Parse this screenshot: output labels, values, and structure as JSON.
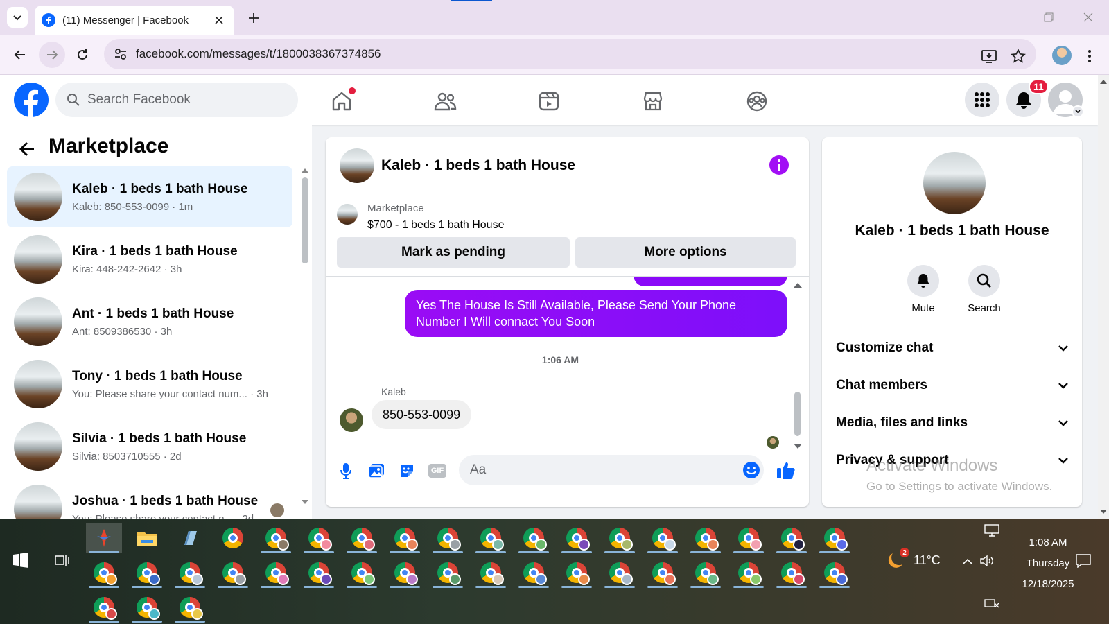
{
  "browser": {
    "tab_title": "(11) Messenger | Facebook",
    "url": "facebook.com/messages/t/1800038367374856"
  },
  "header": {
    "search_placeholder": "Search Facebook",
    "notification_count": "11"
  },
  "sidebar": {
    "title": "Marketplace",
    "chats": [
      {
        "name": "Kaleb · 1 beds 1 bath House",
        "preview": "Kaleb: 850-553-0099 · 1m",
        "active": true
      },
      {
        "name": "Kira · 1 beds 1 bath House",
        "preview": "Kira: 448-242-2642 · 3h"
      },
      {
        "name": "Ant · 1 beds 1 bath House",
        "preview": "Ant: 8509386530 · 3h"
      },
      {
        "name": "Tony · 1 beds 1 bath House",
        "preview": "You: Please share your contact num... · 3h"
      },
      {
        "name": "Silvia · 1 beds 1 bath House",
        "preview": "Silvia: 8503710555 · 2d"
      },
      {
        "name": "Joshua · 1 beds 1 bath House",
        "preview": "You: Please share your contact n... · 2d"
      }
    ]
  },
  "conversation": {
    "title": "Kaleb · 1 beds 1 bath House",
    "listing_source": "Marketplace",
    "listing_title": "$700 - 1 beds 1 bath House",
    "mark_pending_label": "Mark as pending",
    "more_options_label": "More options",
    "outgoing_message": "Yes The House Is Still Available, Please Send Your Phone Number I Will connact You Soon",
    "timestamp": "1:06 AM",
    "sender_name": "Kaleb",
    "incoming_message": "850-553-0099",
    "composer_placeholder": "Aa",
    "gif_label": "GIF"
  },
  "details": {
    "name": "Kaleb · 1 beds 1 bath House",
    "mute_label": "Mute",
    "search_label": "Search",
    "sections": [
      "Customize chat",
      "Chat members",
      "Media, files and links",
      "Privacy & support"
    ]
  },
  "watermark": {
    "line1": "Activate Windows",
    "line2": "Go to Settings to activate Windows."
  },
  "taskbar": {
    "weather_temp": "11°C",
    "weather_badge": "2",
    "time": "1:08 AM",
    "day": "Thursday",
    "date": "12/18/2025"
  },
  "colors": {
    "messenger_purple": "#8a09f8",
    "facebook_blue": "#0866ff",
    "badge_red": "#e41e3f"
  }
}
